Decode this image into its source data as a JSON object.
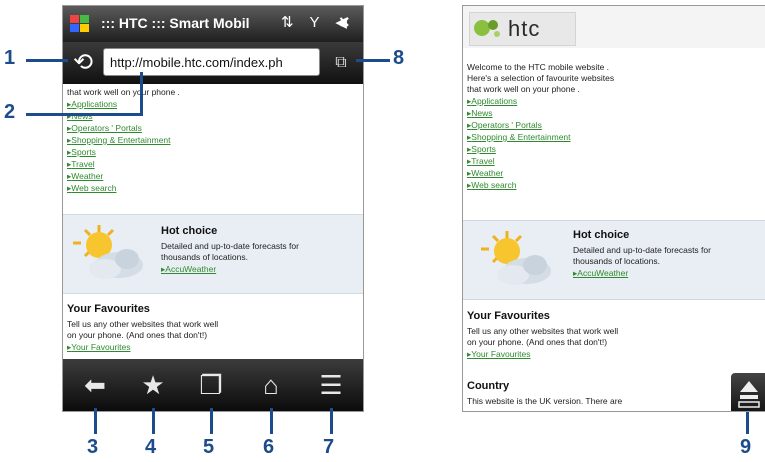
{
  "phone1": {
    "status_bar": {
      "title": "::: HTC ::: Smart Mobil",
      "icons": "⇅ Y ◀",
      "close": "×"
    },
    "address_bar": {
      "url": "http://mobile.htc.com/index.ph",
      "refresh_glyph": "⟲",
      "tabs_glyph": "⧉"
    },
    "content": {
      "intro": "that work well on your phone .",
      "links": [
        "Applications",
        "News",
        "Operators ' Portals",
        "Shopping & Entertainment",
        "Sports",
        "Travel",
        "Weather",
        "Web search"
      ],
      "hot_choice": {
        "title": "Hot choice",
        "line1": "Detailed and up-to-date forecasts for",
        "line2": "thousands of locations.",
        "link": "AccuWeather"
      },
      "favourites": {
        "title": "Your Favourites",
        "line1": "Tell us any other websites that work well",
        "line2": "on your phone. (And ones that don't!)",
        "link": "Your Favourites"
      }
    },
    "toolbar": {
      "back_glyph": "⬅",
      "favorites_glyph": "★",
      "windows_glyph": "❐",
      "home_glyph": "⌂",
      "menu_glyph": "☰"
    }
  },
  "phone2": {
    "logo": "htc",
    "content": {
      "intro_line1": "Welcome to the HTC mobile website .",
      "intro_line2": "Here's a selection of favourite websites",
      "intro_line3": "that work well on your phone .",
      "links": [
        "Applications",
        "News",
        "Operators ' Portals",
        "Shopping & Entertainment",
        "Sports",
        "Travel",
        "Weather",
        "Web search"
      ],
      "hot_choice": {
        "title": "Hot choice",
        "line1": "Detailed and up-to-date forecasts for",
        "line2": "thousands of locations.",
        "link": "AccuWeather"
      },
      "favourites": {
        "title": "Your Favourites",
        "line1": "Tell us any other websites that work well",
        "line2": "on your phone. (And ones that don't!)",
        "link": "Your Favourites"
      },
      "country": {
        "title": "Country",
        "line1": "This website is the UK version. There are"
      }
    },
    "float_glyph": "⏏"
  },
  "callouts": [
    "1",
    "2",
    "3",
    "4",
    "5",
    "6",
    "7",
    "8",
    "9"
  ],
  "colors": {
    "callout": "#1c4c8c",
    "link": "#2f8a2f",
    "toolbar": "#1a1a1a"
  }
}
